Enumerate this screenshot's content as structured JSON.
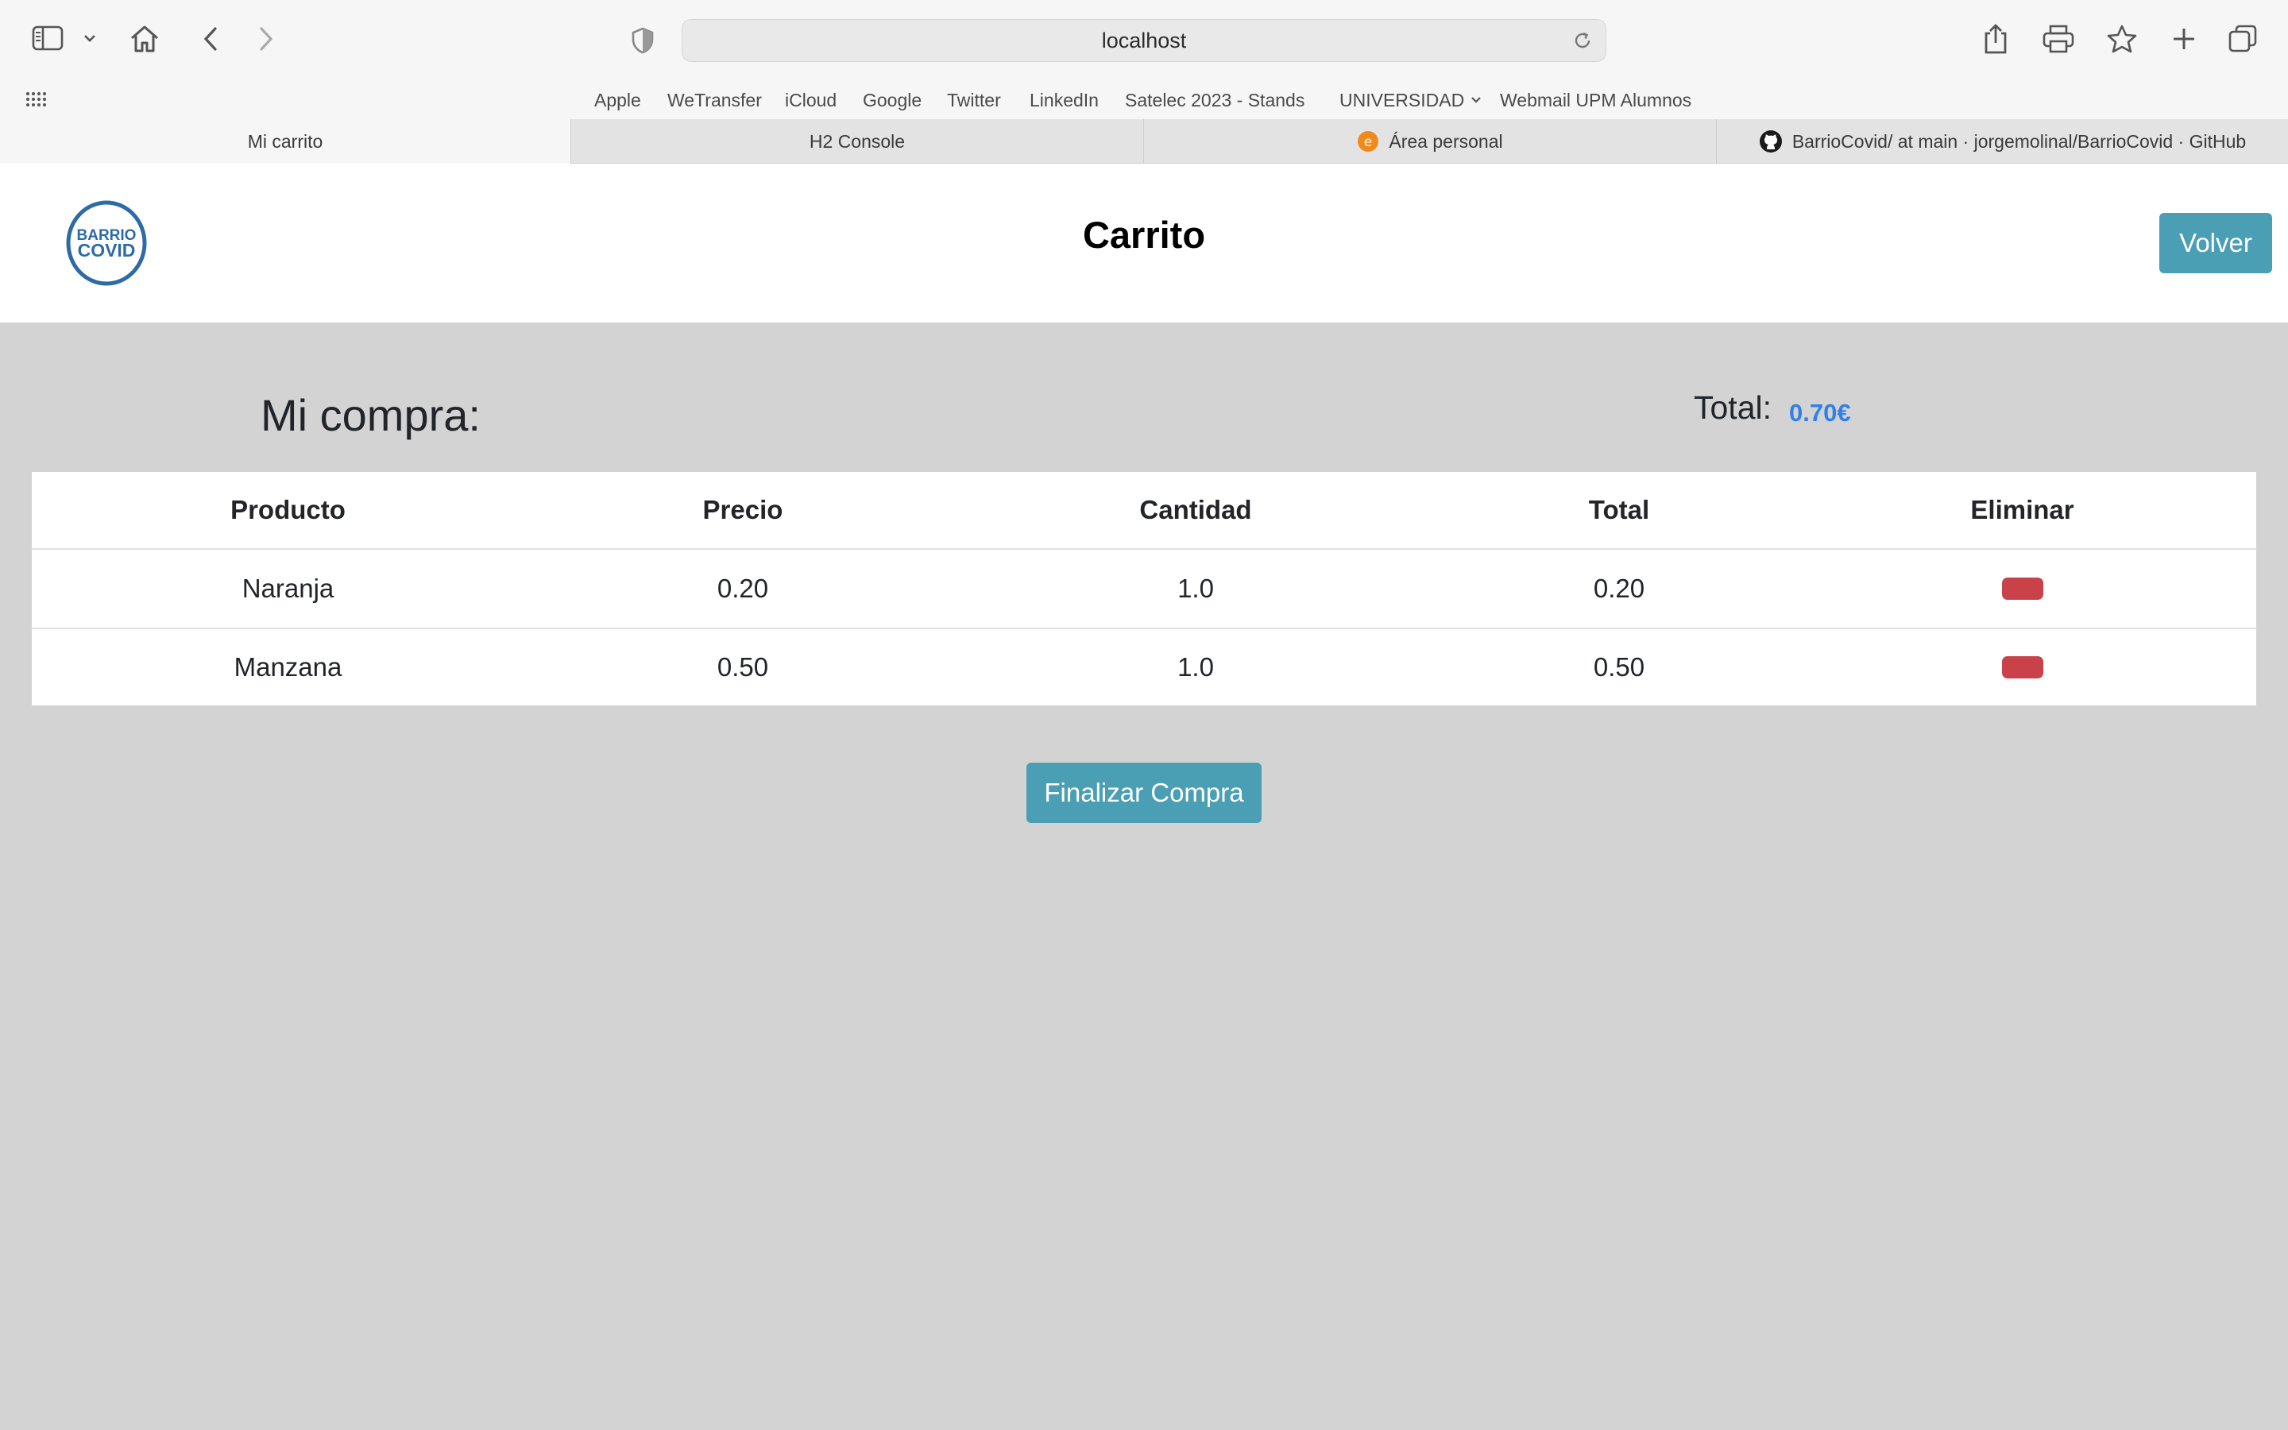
{
  "browser": {
    "url": "localhost",
    "bookmarks": [
      "Apple",
      "WeTransfer",
      "iCloud",
      "Google",
      "Twitter",
      "LinkedIn",
      "Satelec 2023 - Stands",
      "UNIVERSIDAD",
      "Webmail UPM Alumnos"
    ],
    "tabs": [
      {
        "label": "Mi carrito",
        "active": true
      },
      {
        "label": "H2 Console"
      },
      {
        "label": "Área personal"
      },
      {
        "label": "BarrioCovid/ at main · jorgemolinal/BarrioCovid · GitHub"
      }
    ]
  },
  "header": {
    "logo_line1": "BARRIO",
    "logo_line2": "COVID",
    "title": "Carrito",
    "back_button": "Volver"
  },
  "main": {
    "subtitle": "Mi compra:",
    "total_label": "Total:",
    "total_value": "0.70€",
    "columns": [
      "Producto",
      "Precio",
      "Cantidad",
      "Total",
      "Eliminar"
    ],
    "rows": [
      {
        "producto": "Naranja",
        "precio": "0.20",
        "cantidad": "1.0",
        "total": "0.20"
      },
      {
        "producto": "Manzana",
        "precio": "0.50",
        "cantidad": "1.0",
        "total": "0.50"
      }
    ],
    "checkout_button": "Finalizar Compra"
  },
  "colors": {
    "accent_button": "#4a9fb5",
    "delete_button": "#c9424a",
    "total_value": "#2f80ed",
    "page_background": "#d3d3d3"
  }
}
